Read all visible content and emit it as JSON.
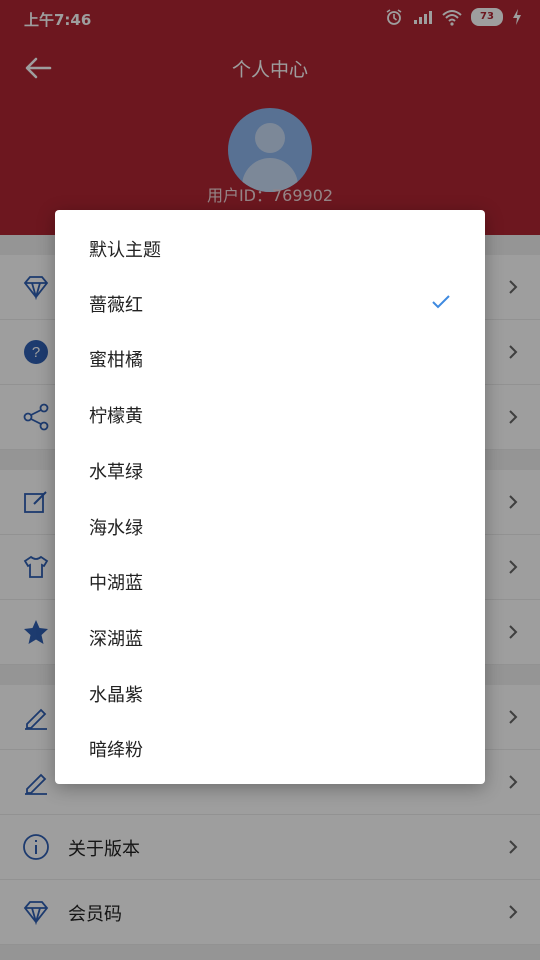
{
  "status_bar": {
    "time": "上午7:46",
    "battery": "73"
  },
  "app_bar": {
    "title": "个人中心"
  },
  "profile": {
    "user_id": "用户ID：769902"
  },
  "menu": {
    "items": [
      {
        "label": "",
        "icon": "diamond-icon"
      },
      {
        "label": "",
        "icon": "help-icon"
      },
      {
        "label": "",
        "icon": "share-icon"
      },
      {
        "label": "",
        "icon": "edit-icon"
      },
      {
        "label": "",
        "icon": "shirt-icon"
      },
      {
        "label": "",
        "icon": "star-icon"
      },
      {
        "label": "",
        "icon": "pencil-icon"
      },
      {
        "label": "",
        "icon": "pencil-icon"
      },
      {
        "label": "关于版本",
        "icon": "info-icon"
      },
      {
        "label": "会员码",
        "icon": "diamond-icon"
      }
    ]
  },
  "theme_dialog": {
    "options": [
      {
        "label": "默认主题",
        "selected": false
      },
      {
        "label": "蔷薇红",
        "selected": true
      },
      {
        "label": "蜜柑橘",
        "selected": false
      },
      {
        "label": "柠檬黄",
        "selected": false
      },
      {
        "label": "水草绿",
        "selected": false
      },
      {
        "label": "海水绿",
        "selected": false
      },
      {
        "label": "中湖蓝",
        "selected": false
      },
      {
        "label": "深湖蓝",
        "selected": false
      },
      {
        "label": "水晶紫",
        "selected": false
      },
      {
        "label": "暗绛粉",
        "selected": false
      }
    ]
  },
  "colors": {
    "theme_accent": "#b02633",
    "check_color": "#3f8ae0",
    "icon_blue": "#2f5fb3"
  }
}
